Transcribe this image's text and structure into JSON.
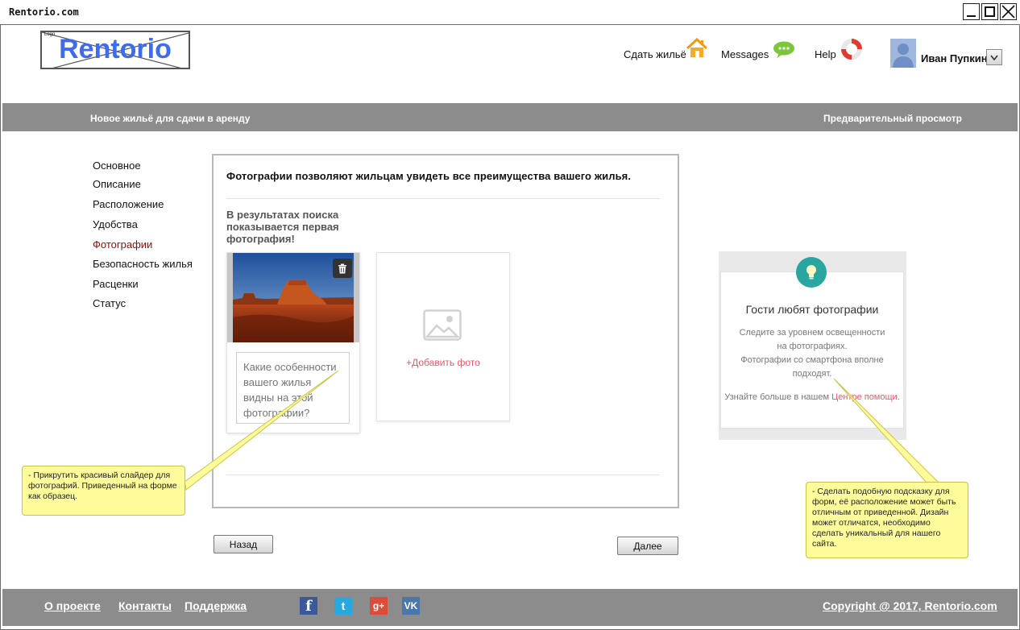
{
  "window": {
    "title": "Rentorio.com"
  },
  "header": {
    "logo_text": "Rentorio",
    "logo_tag": "Logo",
    "nav": {
      "rent_out": "Сдать жильё",
      "messages": "Messages",
      "help": "Help"
    },
    "user": {
      "name": "Иван Пупкин"
    }
  },
  "section_bar": {
    "title": "Новое жильё для сдачи в аренду",
    "preview": "Предварительный просмотр"
  },
  "left_menu": [
    {
      "label": "Основное",
      "active": false
    },
    {
      "label": "Описание",
      "active": false
    },
    {
      "label": "Расположение",
      "active": false
    },
    {
      "label": "Удобства",
      "active": false
    },
    {
      "label": "Фотографии",
      "active": true
    },
    {
      "label": "Безопасность жилья",
      "active": false
    },
    {
      "label": "Расценки",
      "active": false
    },
    {
      "label": "Статус",
      "active": false
    }
  ],
  "main": {
    "intro": "Фотографии позволяют жильцам увидеть все преимущества вашего жилья.",
    "sub_heading": "В результатах поиска показывается первая фотография!",
    "caption_placeholder": "Какие особенности вашего жилья видны на этой фотографии?",
    "add_photo": "+Добавить фото",
    "back": "Назад",
    "next": "Далее"
  },
  "tip": {
    "title": "Гости любят фотографии",
    "lines": [
      "Следите за уровнем освещенности",
      "на фотографиях.",
      "Фотографии со смартфона вполне",
      "подходят."
    ],
    "more_prefix": "Узнайте больше в нашем ",
    "more_link": "Центре помощи",
    "more_suffix": "."
  },
  "notes": {
    "slider": "- Прикрутить красивый слайдер для фотографий. Приведенный на форме как образец.",
    "tip": "- Сделать подобную подсказку для форм, её расположение может быть отличным от приведенной. Дизайн может отличатся, необходимо сделать уникальный для нашего сайта."
  },
  "footer": {
    "about": "О проекте",
    "contacts": "Контакты",
    "support": "Поддержка",
    "social": {
      "facebook": "f",
      "twitter": "t",
      "gplus": "g+",
      "vk": "VK"
    },
    "copyright": "Copyright @ 2017, Rentorio.com"
  },
  "colors": {
    "logo_blue": "#3d6cf0",
    "bar_gray": "#8c8c8c",
    "active_menu": "#8b0c0c",
    "accent_pink": "#e8586a",
    "tip_teal": "#2aa6a0",
    "note_yellow": "#fefc9a"
  },
  "icons": [
    "house-icon",
    "chat-bubble-icon",
    "lifebuoy-icon",
    "avatar-icon",
    "chevron-down-icon",
    "trash-icon",
    "image-icon",
    "lightbulb-icon",
    "facebook-icon",
    "twitter-icon",
    "google-plus-icon",
    "vk-icon"
  ]
}
